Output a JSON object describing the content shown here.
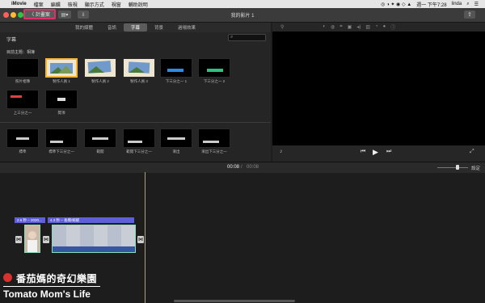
{
  "menubar": {
    "apple_glyph": "",
    "app_name": "iMovie",
    "items": [
      "檔案",
      "編輯",
      "檢視",
      "顯示方式",
      "視窗",
      "輔助說明"
    ],
    "clock": "週一 下午7:28",
    "user": "linda"
  },
  "toolbar": {
    "projects_label": "〈 計畫案",
    "window_title": "我的影片 1",
    "share_glyph": "⇪"
  },
  "tabs": [
    {
      "label": "我的媒體",
      "active": false
    },
    {
      "label": "音訊",
      "active": false
    },
    {
      "label": "字幕",
      "active": true
    },
    {
      "label": "背景",
      "active": false
    },
    {
      "label": "過場效果",
      "active": false
    }
  ],
  "browser": {
    "section_label": "字幕",
    "search_placeholder": "",
    "group_label": "目前主題：相簿",
    "row1": [
      {
        "label": "照片相簿",
        "style": "album"
      },
      {
        "label": "製作人員 1",
        "style": "album"
      },
      {
        "label": "製作人員 2",
        "style": "album"
      },
      {
        "label": "製作人員 3",
        "style": "album"
      },
      {
        "label": "下三分之一 1",
        "style": "lower-blue"
      },
      {
        "label": "下三分之一 2",
        "style": "lower-green"
      }
    ],
    "row2": [
      {
        "label": "上三分之一",
        "style": "upper-red"
      },
      {
        "label": "獎項",
        "style": "award"
      }
    ],
    "row3": [
      {
        "label": "標準"
      },
      {
        "label": "標準下三分之一"
      },
      {
        "label": "範開"
      },
      {
        "label": "範開下三分之一"
      },
      {
        "label": "漸出"
      },
      {
        "label": "漸出下三分之一"
      }
    ]
  },
  "timeline": {
    "current_time": "00:08",
    "total_time": "00:08",
    "settings_label": "設定",
    "clips": [
      {
        "label": "2.6 秒 – 2020..."
      },
      {
        "label": "4.3 秒 – 長橋/蜿蜒"
      }
    ]
  },
  "watermark": {
    "line1": "番茄媽的奇幻樂園",
    "line2": "Tomato Mom's Life"
  }
}
